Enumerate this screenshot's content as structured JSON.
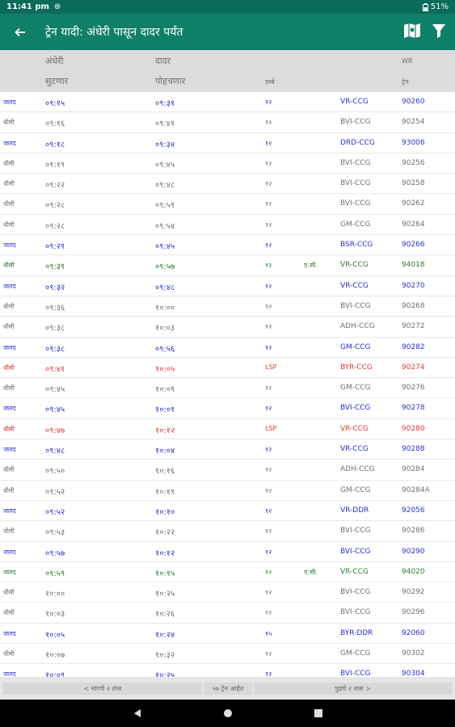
{
  "status_bar": {
    "time": "11:41 pm",
    "battery": "51%"
  },
  "app_bar": {
    "title": "ट्रेन यादी: अंधेरी पासून दादर पर्यंत",
    "icons": [
      "back-arrow-icon",
      "map-icon",
      "filter-icon"
    ]
  },
  "header": {
    "from_station": "अंधेरी",
    "to_station": "दादर",
    "line": "WR",
    "departs_label": "सुटणार",
    "arrives_label": "पोहचणार",
    "cars_label": "डब्बे",
    "train_label": "ट्रेन"
  },
  "rows": [
    {
      "type": "जलद",
      "dep": "०९:१५",
      "arr": "०९:३१",
      "cars": "१२",
      "ac": "",
      "code": "VR-CCG",
      "no": "90260",
      "cls": "fast"
    },
    {
      "type": "धीमी",
      "dep": "०९:१६",
      "arr": "०९:४१",
      "cars": "१२",
      "ac": "",
      "code": "BVI-CCG",
      "no": "90254",
      "cls": "slow"
    },
    {
      "type": "जलद",
      "dep": "०९:१८",
      "arr": "०९:३४",
      "cars": "१२",
      "ac": "",
      "code": "DRD-CCG",
      "no": "93006",
      "cls": "fast"
    },
    {
      "type": "धीमी",
      "dep": "०९:१९",
      "arr": "०९:४५",
      "cars": "१२",
      "ac": "",
      "code": "BVI-CCG",
      "no": "90256",
      "cls": "slow"
    },
    {
      "type": "धीमी",
      "dep": "०९:२२",
      "arr": "०९:४८",
      "cars": "१२",
      "ac": "",
      "code": "BVI-CCG",
      "no": "90258",
      "cls": "slow"
    },
    {
      "type": "धीमी",
      "dep": "०९:२८",
      "arr": "०९:५१",
      "cars": "१२",
      "ac": "",
      "code": "BVI-CCG",
      "no": "90262",
      "cls": "slow"
    },
    {
      "type": "धीमी",
      "dep": "०९:२८",
      "arr": "०९:५४",
      "cars": "१२",
      "ac": "",
      "code": "GM-CCG",
      "no": "90264",
      "cls": "slow"
    },
    {
      "type": "जलद",
      "dep": "०९:२९",
      "arr": "०९:४५",
      "cars": "१२",
      "ac": "",
      "code": "BSR-CCG",
      "no": "90266",
      "cls": "fast"
    },
    {
      "type": "धीमी",
      "dep": "०९:३१",
      "arr": "०९:५७",
      "cars": "१२",
      "ac": "ए.सी.",
      "code": "VR-CCG",
      "no": "94018",
      "cls": "ac"
    },
    {
      "type": "जलद",
      "dep": "०९:३२",
      "arr": "०९:४८",
      "cars": "१२",
      "ac": "",
      "code": "VR-CCG",
      "no": "90270",
      "cls": "fast"
    },
    {
      "type": "धीमी",
      "dep": "०९:३६",
      "arr": "१०:००",
      "cars": "१२",
      "ac": "",
      "code": "BVI-CCG",
      "no": "90268",
      "cls": "slow"
    },
    {
      "type": "धीमी",
      "dep": "०९:३८",
      "arr": "१०:०३",
      "cars": "१२",
      "ac": "",
      "code": "ADH-CCG",
      "no": "90272",
      "cls": "slow"
    },
    {
      "type": "जलद",
      "dep": "०९:३८",
      "arr": "०९:५६",
      "cars": "१२",
      "ac": "",
      "code": "GM-CCG",
      "no": "90282",
      "cls": "fast"
    },
    {
      "type": "धीमी",
      "dep": "०९:४१",
      "arr": "१०:०५",
      "cars": "LSP",
      "ac": "",
      "code": "BYR-CCG",
      "no": "90274",
      "cls": "lady"
    },
    {
      "type": "धीमी",
      "dep": "०९:४५",
      "arr": "१०:०९",
      "cars": "१२",
      "ac": "",
      "code": "GM-CCG",
      "no": "90276",
      "cls": "slow"
    },
    {
      "type": "जलद",
      "dep": "०९:४५",
      "arr": "१०:०१",
      "cars": "१२",
      "ac": "",
      "code": "BVI-CCG",
      "no": "90278",
      "cls": "fast"
    },
    {
      "type": "धीमी",
      "dep": "०९:४७",
      "arr": "१०:१२",
      "cars": "LSP",
      "ac": "",
      "code": "VR-CCG",
      "no": "90280",
      "cls": "lady"
    },
    {
      "type": "जलद",
      "dep": "०९:४८",
      "arr": "१०:०४",
      "cars": "१२",
      "ac": "",
      "code": "VR-CCG",
      "no": "90288",
      "cls": "fast"
    },
    {
      "type": "धीमी",
      "dep": "०९:५०",
      "arr": "१०:१६",
      "cars": "१२",
      "ac": "",
      "code": "ADH-CCG",
      "no": "90284",
      "cls": "slow"
    },
    {
      "type": "धीमी",
      "dep": "०९:५२",
      "arr": "१०:१९",
      "cars": "१२",
      "ac": "",
      "code": "GM-CCG",
      "no": "90284A",
      "cls": "slow"
    },
    {
      "type": "जलद",
      "dep": "०९:५२",
      "arr": "१०:१०",
      "cars": "१२",
      "ac": "",
      "code": "VR-DDR",
      "no": "92056",
      "cls": "fast"
    },
    {
      "type": "धीमी",
      "dep": "०९:५३",
      "arr": "१०:२२",
      "cars": "१२",
      "ac": "",
      "code": "BVI-CCG",
      "no": "90286",
      "cls": "slow"
    },
    {
      "type": "जलद",
      "dep": "०९:५७",
      "arr": "१०:१२",
      "cars": "१२",
      "ac": "",
      "code": "BVI-CCG",
      "no": "90290",
      "cls": "fast"
    },
    {
      "type": "जलद",
      "dep": "०९:५९",
      "arr": "१०:१५",
      "cars": "१२",
      "ac": "ए.सी.",
      "code": "VR-CCG",
      "no": "94020",
      "cls": "ac"
    },
    {
      "type": "धीमी",
      "dep": "१०:००",
      "arr": "१०:२५",
      "cars": "१२",
      "ac": "",
      "code": "BVI-CCG",
      "no": "90292",
      "cls": "slow"
    },
    {
      "type": "धीमी",
      "dep": "१०:०३",
      "arr": "१०:२६",
      "cars": "१२",
      "ac": "",
      "code": "BVI-CCG",
      "no": "90296",
      "cls": "slow"
    },
    {
      "type": "जलद",
      "dep": "१०:०५",
      "arr": "१०:२४",
      "cars": "१५",
      "ac": "",
      "code": "BYR-DDR",
      "no": "92060",
      "cls": "fast"
    },
    {
      "type": "धीमी",
      "dep": "१०:०७",
      "arr": "१०:३२",
      "cars": "१२",
      "ac": "",
      "code": "GM-CCG",
      "no": "90302",
      "cls": "slow"
    },
    {
      "type": "जलद",
      "dep": "१०:०९",
      "arr": "१०:२५",
      "cars": "१२",
      "ac": "",
      "code": "BVI-CCG",
      "no": "90304",
      "cls": "fast"
    }
  ],
  "footer": {
    "prev_label": "< मागचे २ तास",
    "count_label": "५७ ट्रेन आहेत",
    "next_label": "पुढचे २ तास >"
  }
}
